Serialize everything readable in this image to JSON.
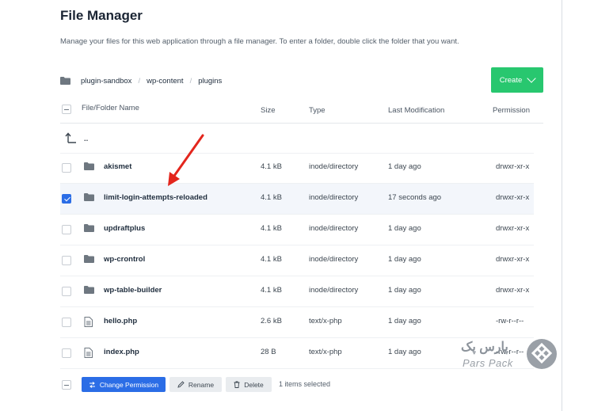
{
  "page": {
    "title": "File Manager",
    "description": "Manage your files for this web application through a file manager. To enter a folder, double click the folder that you want."
  },
  "breadcrumb": [
    "plugin-sandbox",
    "wp-content",
    "plugins"
  ],
  "create_button": {
    "label": "Create"
  },
  "table": {
    "headers": {
      "name": "File/Folder Name",
      "size": "Size",
      "type": "Type",
      "modified": "Last Modification",
      "permission": "Permission"
    },
    "parent_label": "..",
    "rows": [
      {
        "kind": "folder",
        "name": "akismet",
        "size": "4.1 kB",
        "type": "inode/directory",
        "modified": "1 day ago",
        "permission": "drwxr-xr-x",
        "checked": false
      },
      {
        "kind": "folder",
        "name": "limit-login-attempts-reloaded",
        "size": "4.1 kB",
        "type": "inode/directory",
        "modified": "17 seconds ago",
        "permission": "drwxr-xr-x",
        "checked": true
      },
      {
        "kind": "folder",
        "name": "updraftplus",
        "size": "4.1 kB",
        "type": "inode/directory",
        "modified": "1 day ago",
        "permission": "drwxr-xr-x",
        "checked": false
      },
      {
        "kind": "folder",
        "name": "wp-crontrol",
        "size": "4.1 kB",
        "type": "inode/directory",
        "modified": "1 day ago",
        "permission": "drwxr-xr-x",
        "checked": false
      },
      {
        "kind": "folder",
        "name": "wp-table-builder",
        "size": "4.1 kB",
        "type": "inode/directory",
        "modified": "1 day ago",
        "permission": "drwxr-xr-x",
        "checked": false
      },
      {
        "kind": "file",
        "name": "hello.php",
        "size": "2.6 kB",
        "type": "text/x-php",
        "modified": "1 day ago",
        "permission": "-rw-r--r--",
        "checked": false
      },
      {
        "kind": "file",
        "name": "index.php",
        "size": "28 B",
        "type": "text/x-php",
        "modified": "1 day ago",
        "permission": "-rw-r--r--",
        "checked": false
      }
    ]
  },
  "footer": {
    "change_permission": "Change Permission",
    "rename": "Rename",
    "delete": "Delete",
    "selection_status": "1 items selected"
  },
  "watermark": {
    "fa": "پارس پک",
    "en": "Pars Pack"
  },
  "colors": {
    "accent_green": "#28c76f",
    "accent_blue": "#2b6de6",
    "annotation_red": "#e3261d"
  }
}
